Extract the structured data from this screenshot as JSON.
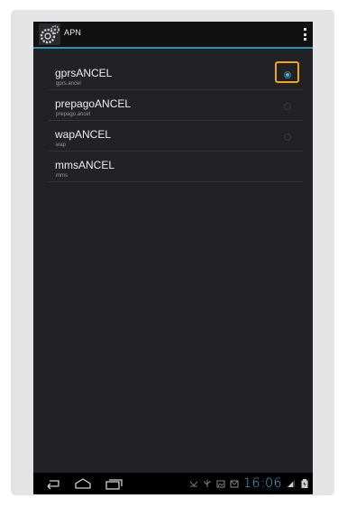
{
  "app": {
    "title": "APN",
    "icon": "settings-gears-icon"
  },
  "actionbar": {
    "overflow_icon": "overflow-menu-icon"
  },
  "apn_list": [
    {
      "name": "gprsANCEL",
      "apn": "gprs.ancel",
      "selected": true,
      "focused": true
    },
    {
      "name": "prepagoANCEL",
      "apn": "prepago.ancel",
      "selected": false,
      "radio": true
    },
    {
      "name": "wapANCEL",
      "apn": "wap",
      "selected": false,
      "radio": true
    },
    {
      "name": "mmsANCEL",
      "apn": "mms",
      "selected": false,
      "radio": false
    }
  ],
  "navbar": {
    "buttons": [
      "back-icon",
      "home-icon",
      "recent-apps-icon"
    ],
    "status_icons": [
      "notification-chevron-icon",
      "usb-icon",
      "image-icon",
      "mail-icon",
      "signal-icon",
      "battery-icon"
    ],
    "time": "16:06"
  },
  "colors": {
    "accent": "#33b5e5",
    "focus": "#f0a420",
    "background": "#222224"
  }
}
